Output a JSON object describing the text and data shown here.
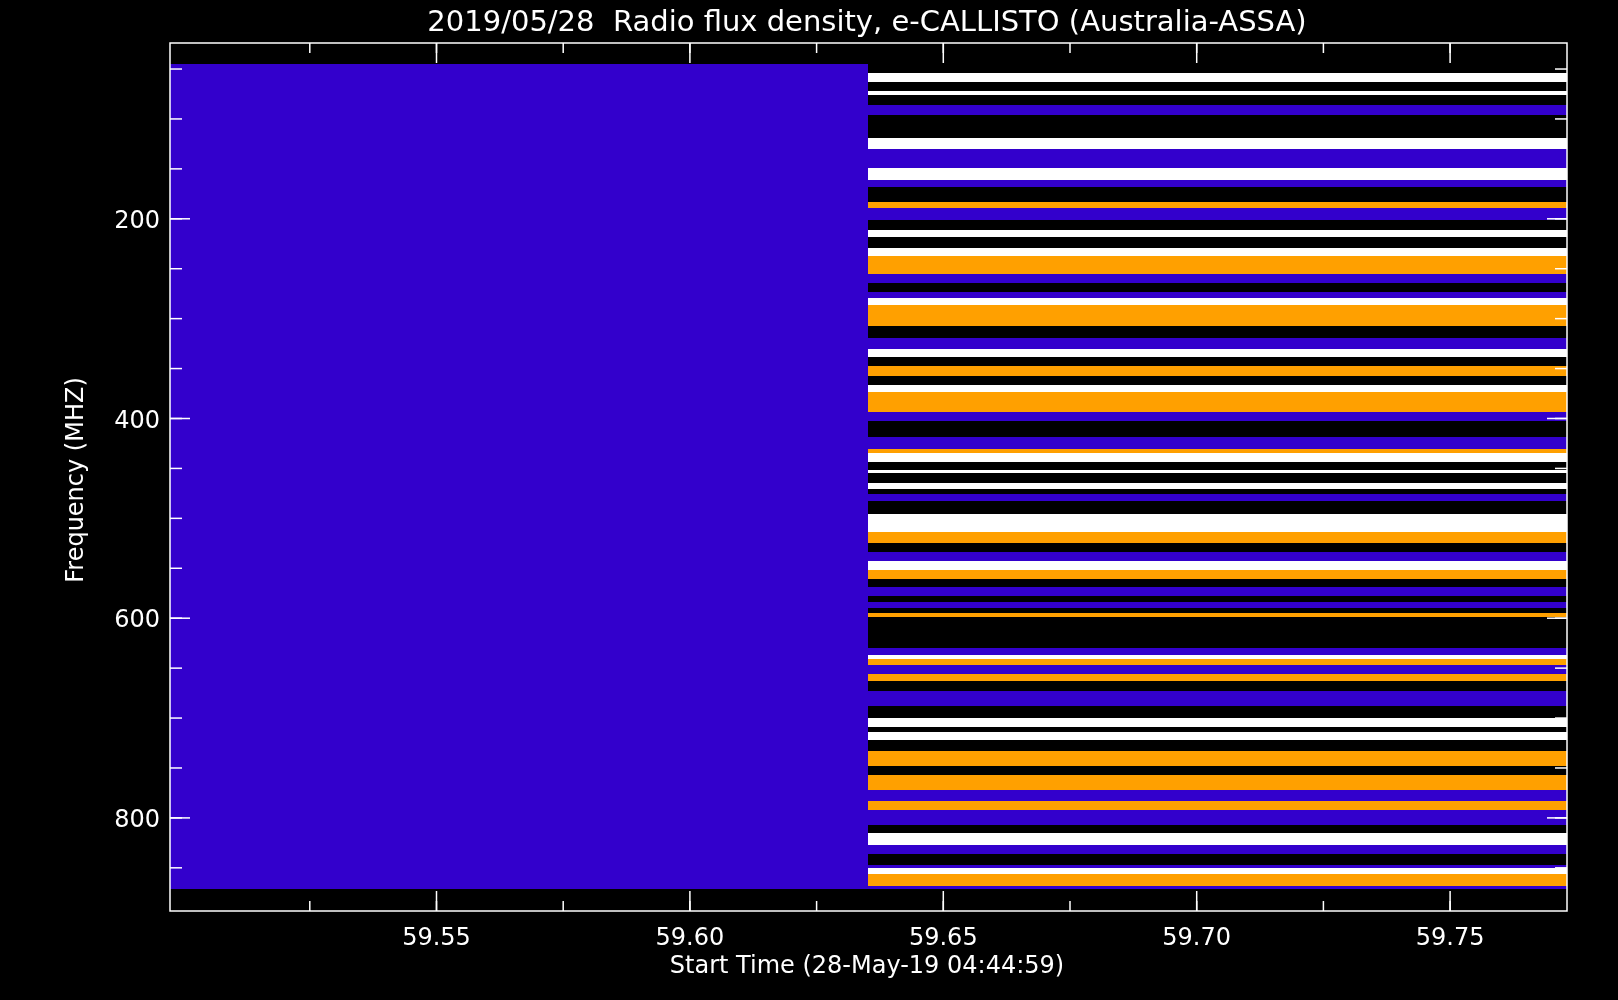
{
  "title": "2019/05/28  Radio flux density, e-CALLISTO (Australia-ASSA)",
  "y_axis": {
    "label": "Frequency (MHZ)",
    "ticks": [
      "200",
      "400",
      "600",
      "800"
    ]
  },
  "x_axis": {
    "label": "Start Time (28-May-19 04:44:59)",
    "ticks": [
      "59.55",
      "59.60",
      "59.65",
      "59.70",
      "59.75"
    ]
  }
}
